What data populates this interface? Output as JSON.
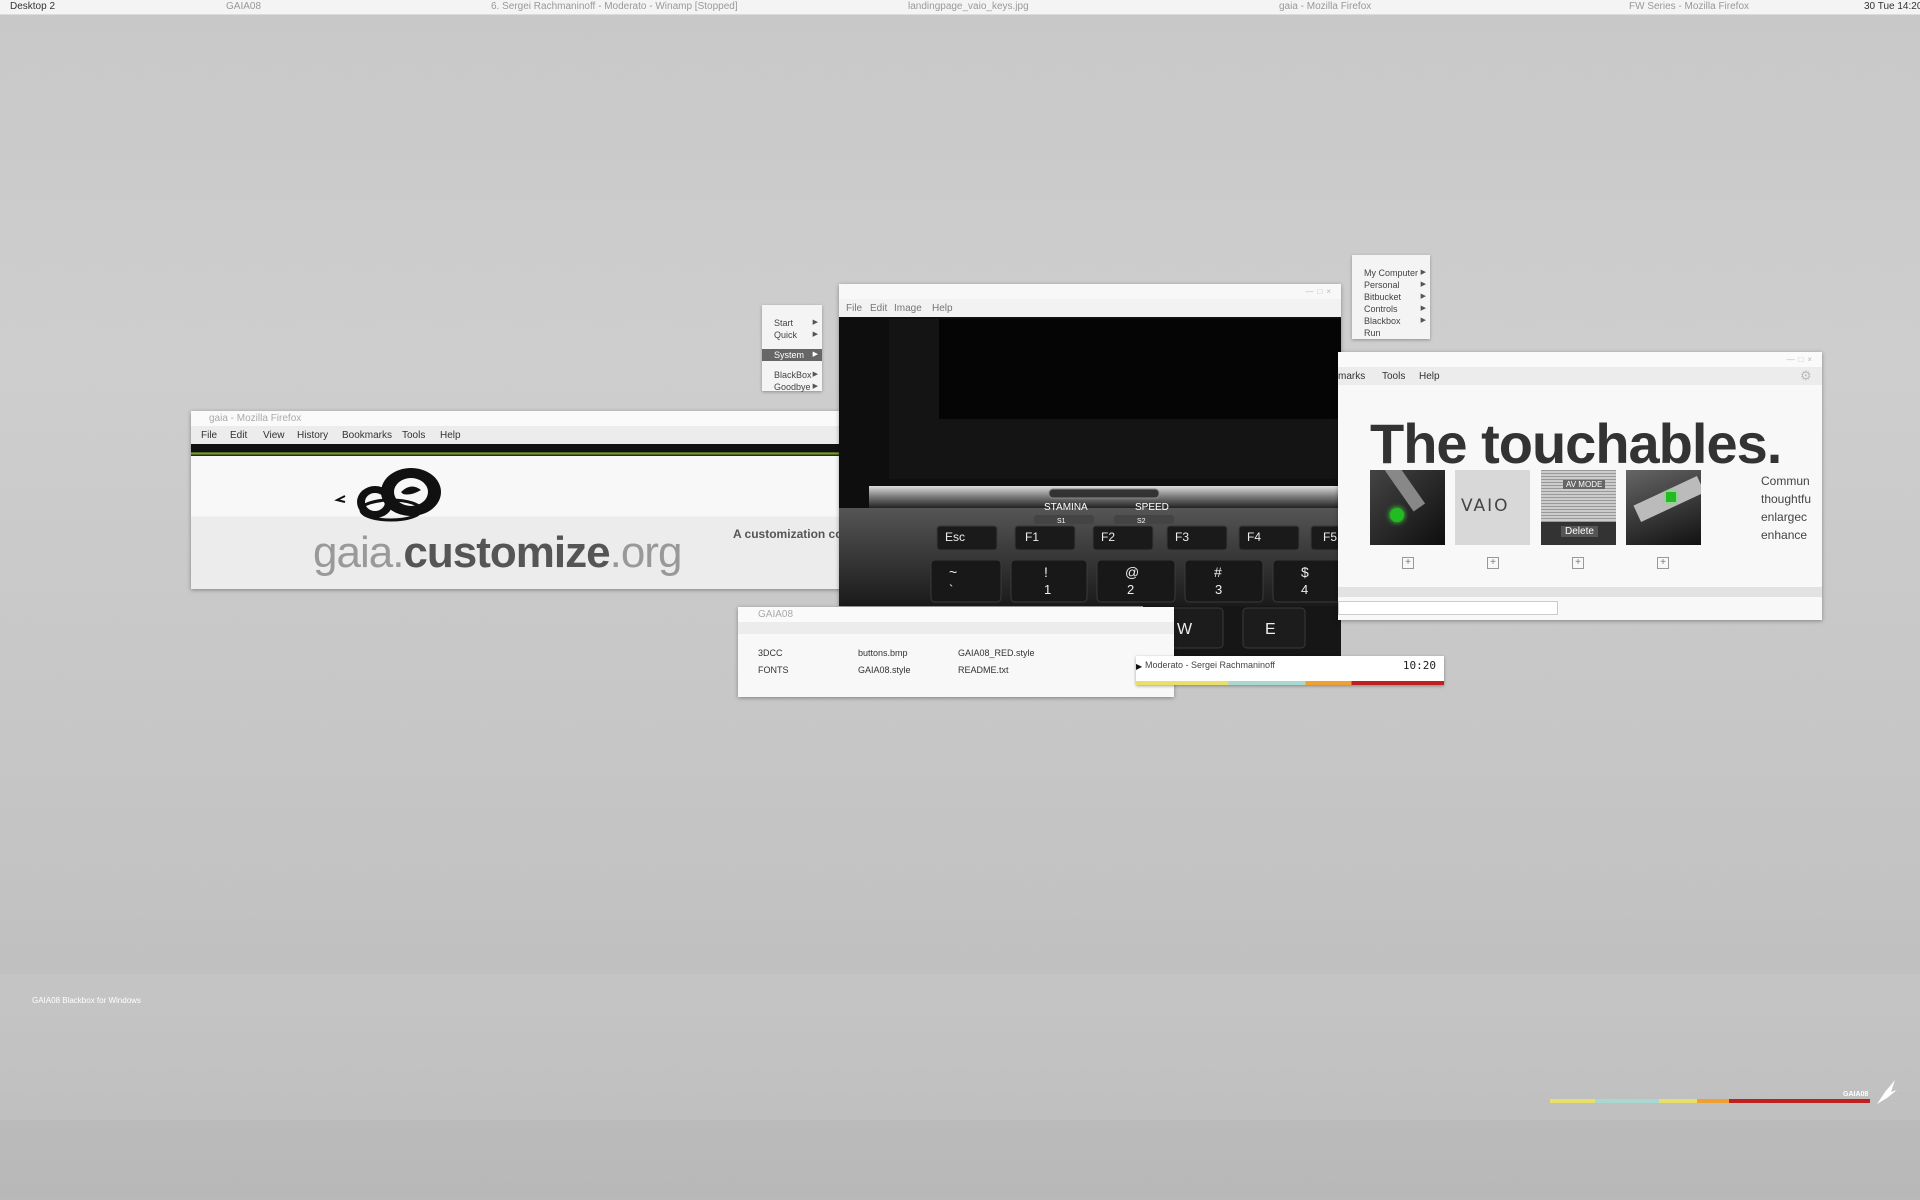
{
  "toolbar": {
    "workspace": "Desktop 2",
    "tasks": [
      "GAIA08",
      "6. Sergei Rachmaninoff - Moderato - Winamp [Stopped]",
      "landingpage_vaio_keys.jpg",
      "gaia - Mozilla Firefox",
      "FW Series - Mozilla Firefox"
    ],
    "clock": "30 Tue 14:20"
  },
  "firefox_gaia": {
    "title": "gaia - Mozilla Firefox",
    "menu": [
      "File",
      "Edit",
      "View",
      "History",
      "Bookmarks",
      "Tools",
      "Help"
    ],
    "brand_light": "gaia.",
    "brand_bold": "customize",
    "brand_tail": ".org",
    "tagline": "A customization co"
  },
  "viewer": {
    "menu": [
      "File",
      "Edit",
      "Image",
      "Help"
    ],
    "keys_row1": [
      "Esc",
      "F1",
      "F2",
      "F3",
      "F4",
      "F5"
    ],
    "keys_row2": [
      "~",
      "!",
      "@",
      "#",
      "$"
    ],
    "keys_row2_sub": [
      "`",
      "1",
      "2",
      "3",
      "4"
    ],
    "keys_row3": [
      "W",
      "E"
    ],
    "switch_left": "STAMINA",
    "switch_right": "SPEED",
    "switch_left_sub": "S1",
    "switch_right_sub": "S2"
  },
  "firefox_fw": {
    "menu": [
      "marks",
      "Tools",
      "Help"
    ],
    "headline": "The touchables.",
    "thumb_vaio": "VAIO",
    "thumb_avmode": "AV MODE",
    "thumb_delete": "Delete",
    "side_text": [
      "Commun",
      "thoughtfu",
      "enlargec",
      "enhance"
    ]
  },
  "root_menu_left": {
    "items": [
      {
        "label": "Start",
        "submenu": true
      },
      {
        "label": "Quick",
        "submenu": true
      },
      {
        "label": "System",
        "submenu": true,
        "selected": true
      },
      {
        "label": "BlackBox",
        "submenu": true
      },
      {
        "label": "Goodbye",
        "submenu": true
      }
    ]
  },
  "root_menu_right": {
    "items": [
      {
        "label": "My Computer",
        "submenu": true
      },
      {
        "label": "Personal",
        "submenu": true
      },
      {
        "label": "Bitbucket",
        "submenu": true
      },
      {
        "label": "Controls",
        "submenu": true
      },
      {
        "label": "Blackbox",
        "submenu": true
      },
      {
        "label": "Run",
        "submenu": false
      }
    ]
  },
  "file_manager": {
    "title": "GAIA08",
    "files": [
      [
        "3DCC",
        "buttons.bmp",
        "GAIA08_RED.style"
      ],
      [
        "FONTS",
        "GAIA08.style",
        "README.txt"
      ]
    ]
  },
  "winamp": {
    "track": "Moderato - Sergei Rachmaninoff",
    "time": "10:20"
  },
  "desktop": {
    "caption": "GAIA08 Blackbox for Windows",
    "logo_label": "GAIA08"
  },
  "colors": {
    "accent_green": "#99cc33",
    "bar_yellow": "#e8e06a",
    "bar_teal": "#a8d8d0",
    "bar_orange": "#f0a030",
    "bar_red": "#c02020",
    "selected_menu": "#666666"
  }
}
